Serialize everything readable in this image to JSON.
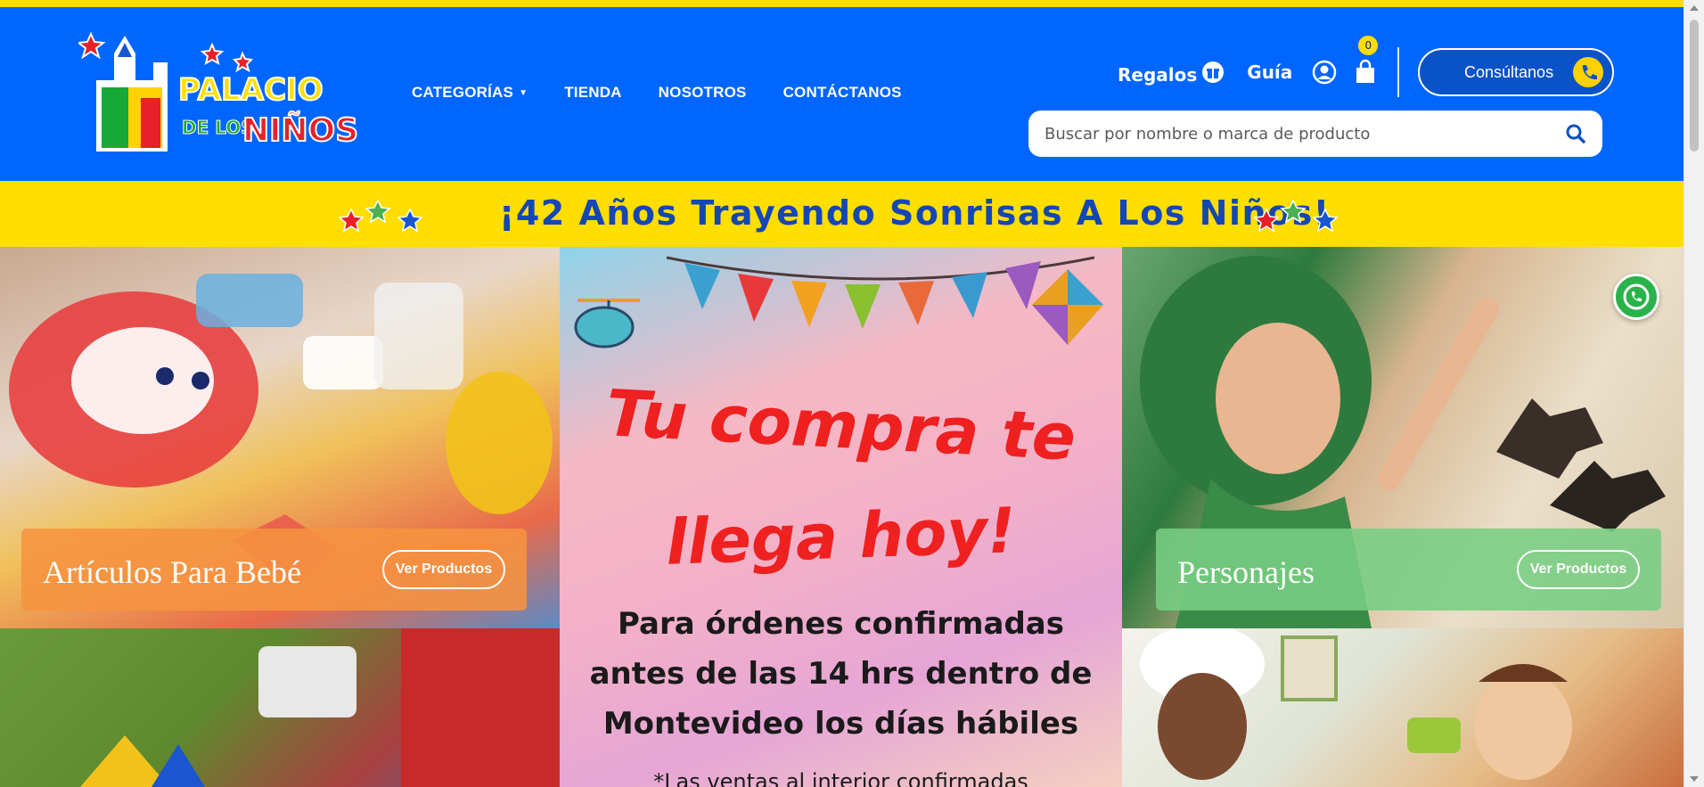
{
  "brand": {
    "logo_alt": "Palacio de los Niños"
  },
  "nav": [
    {
      "label": "CATEGORÍAS",
      "has_dropdown": true
    },
    {
      "label": "TIENDA"
    },
    {
      "label": "NOSOTROS"
    },
    {
      "label": "CONTÁCTANOS"
    }
  ],
  "top_links": {
    "gifts": "Regalos",
    "guide": "Guía",
    "cart_count": "0"
  },
  "consult_button": "Consúltanos",
  "search": {
    "placeholder": "Buscar por nombre o marca de producto"
  },
  "banner": "¡42 Años Trayendo Sonrisas A Los Niños!",
  "categories": [
    {
      "title": "Artículos Para Bebé",
      "button": "Ver Productos"
    },
    {
      "title": "Personajes",
      "button": "Ver Productos"
    }
  ],
  "promo": {
    "line1": "Tu compra te",
    "line2": "llega hoy!",
    "body_lines": [
      "Para órdenes confirmadas",
      "antes de las 14 hrs dentro de",
      "Montevideo los días hábiles"
    ],
    "footnote": "*Las ventas al interior confirmadas"
  },
  "colors": {
    "header_blue": "#0066ff",
    "banner_yellow": "#ffde00",
    "banner_text": "#1447b5",
    "promo_red": "#ee2020"
  }
}
